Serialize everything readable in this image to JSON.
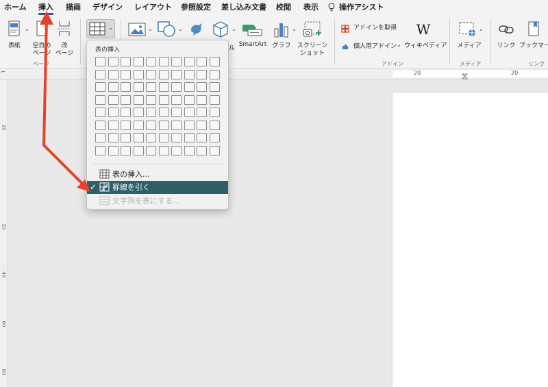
{
  "tabs": [
    {
      "label": "ホーム"
    },
    {
      "label": "挿入"
    },
    {
      "label": "描画"
    },
    {
      "label": "デザイン"
    },
    {
      "label": "レイアウト"
    },
    {
      "label": "参照設定"
    },
    {
      "label": "差し込み文書"
    },
    {
      "label": "校閲"
    },
    {
      "label": "表示"
    },
    {
      "label": "操作アシスト"
    }
  ],
  "ribbon": {
    "cover": "表紙",
    "blank_page_1": "空白の",
    "blank_page_2": "ページ",
    "page_break_1": "改",
    "page_break_2": "ページ",
    "smartart": "SmartArt",
    "graph": "グラフ",
    "screenshot_1": "スクリーン",
    "screenshot_2": "ショット",
    "get_addins": "アドインを取得",
    "personal_addins": "個人用アドイン",
    "wikipedia": "ウィキペディア",
    "media": "メディア",
    "link": "リンク",
    "bookmark": "ブックマーク",
    "group_pages": "ページ",
    "group_addins": "アドイン",
    "group_media": "メディア",
    "group_links": "リンク",
    "partial_label": "ル"
  },
  "ruler": {
    "h1": "20",
    "h2": "20",
    "v": [
      "20",
      "20",
      "40",
      "60",
      "80"
    ]
  },
  "dropdown": {
    "title": "表の挿入",
    "items": [
      {
        "label": "表の挿入..."
      },
      {
        "label": "罫線を引く",
        "checked": "✓"
      },
      {
        "label": "文字列を表にする..."
      }
    ]
  },
  "colors": {
    "accent": "#2b579a",
    "selected": "#2f6068",
    "annotation": "#e8412a"
  }
}
